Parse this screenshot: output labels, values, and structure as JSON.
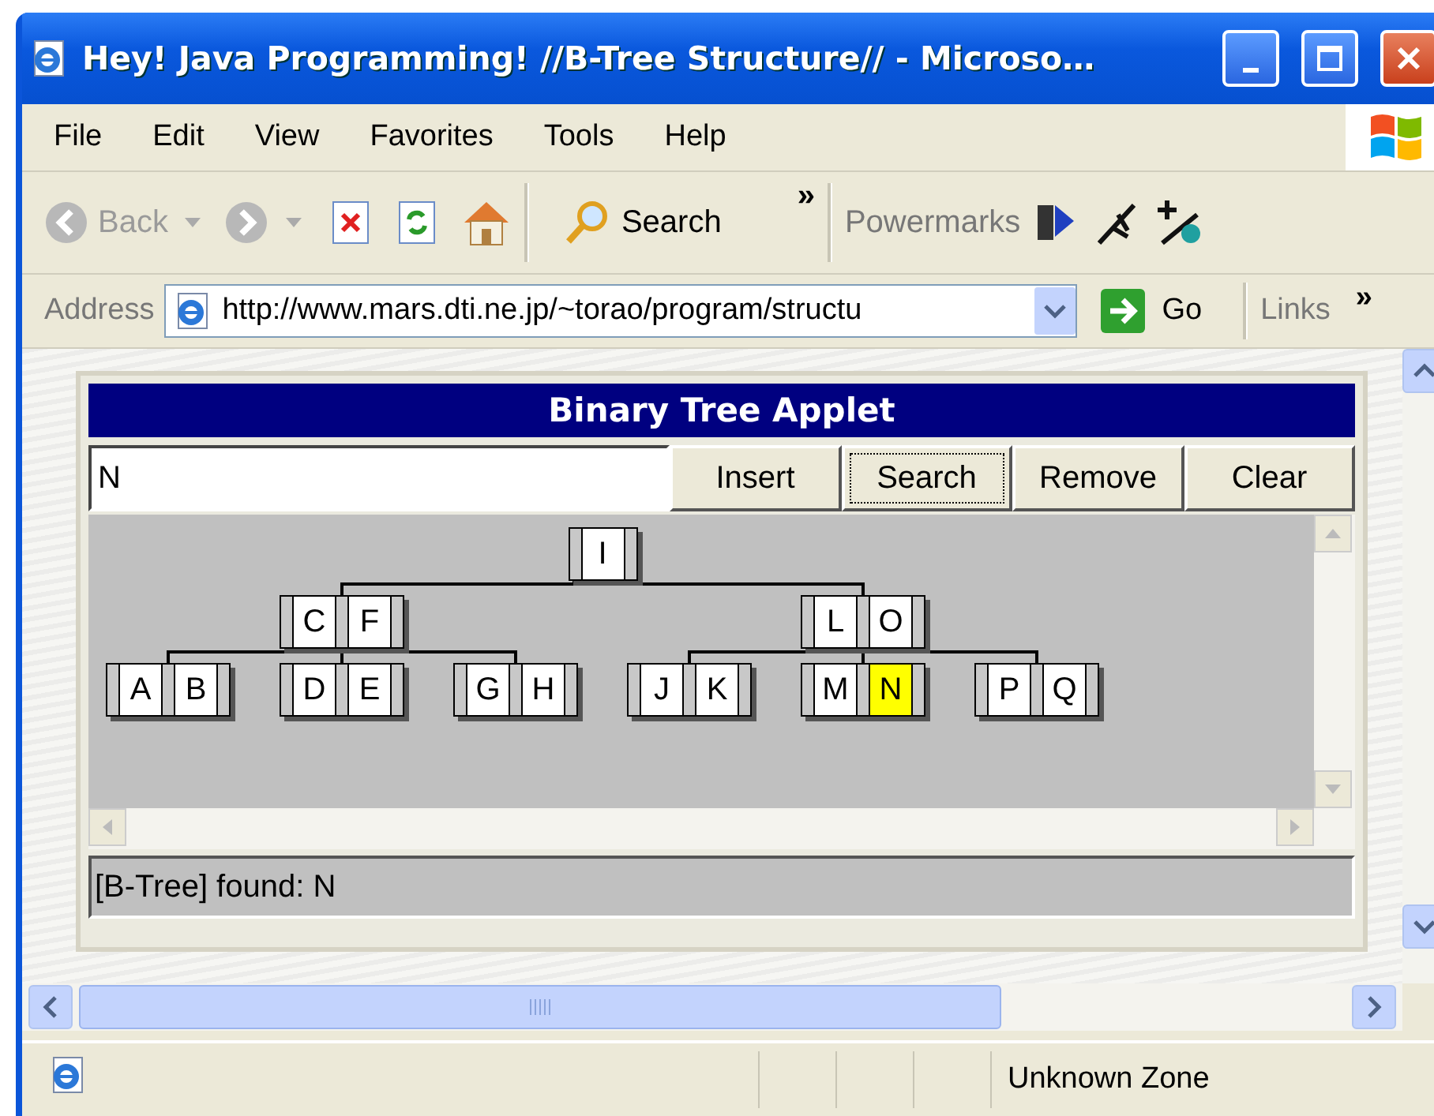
{
  "window": {
    "title": "Hey! Java Programming! //B-Tree Structure// - Microso…"
  },
  "menu": [
    "File",
    "Edit",
    "View",
    "Favorites",
    "Tools",
    "Help"
  ],
  "toolbar": {
    "back": {
      "label": "Back",
      "disabled": true
    },
    "search": "Search",
    "more": "»",
    "powermarks": "Powermarks"
  },
  "address": {
    "label": "Address",
    "url": "http://www.mars.dti.ne.jp/~torao/program/structu",
    "go": "Go",
    "links": "Links",
    "more": "»"
  },
  "applet": {
    "title": "Binary Tree Applet",
    "input": {
      "value": "N"
    },
    "buttons": [
      {
        "label": "Insert",
        "focused": false
      },
      {
        "label": "Search",
        "focused": true
      },
      {
        "label": "Remove",
        "focused": false
      },
      {
        "label": "Clear",
        "focused": false
      }
    ],
    "tree": {
      "keys": [
        {
          "label": "I",
          "selected": false
        }
      ],
      "children": [
        {
          "keys": [
            {
              "label": "C",
              "selected": false
            },
            {
              "label": "F",
              "selected": false
            }
          ],
          "children": [
            {
              "keys": [
                {
                  "label": "A",
                  "selected": false
                },
                {
                  "label": "B",
                  "selected": false
                }
              ]
            },
            {
              "keys": [
                {
                  "label": "D",
                  "selected": false
                },
                {
                  "label": "E",
                  "selected": false
                }
              ]
            },
            {
              "keys": [
                {
                  "label": "G",
                  "selected": false
                },
                {
                  "label": "H",
                  "selected": false
                }
              ]
            }
          ]
        },
        {
          "keys": [
            {
              "label": "L",
              "selected": false
            },
            {
              "label": "O",
              "selected": false
            }
          ],
          "children": [
            {
              "keys": [
                {
                  "label": "J",
                  "selected": false
                },
                {
                  "label": "K",
                  "selected": false
                }
              ]
            },
            {
              "keys": [
                {
                  "label": "M",
                  "selected": false
                },
                {
                  "label": "N",
                  "selected": true
                }
              ]
            },
            {
              "keys": [
                {
                  "label": "P",
                  "selected": false
                },
                {
                  "label": "Q",
                  "selected": false
                }
              ]
            }
          ]
        }
      ]
    },
    "status": "[B-Tree] found: N"
  },
  "status_bar": {
    "zone": "Unknown Zone"
  }
}
